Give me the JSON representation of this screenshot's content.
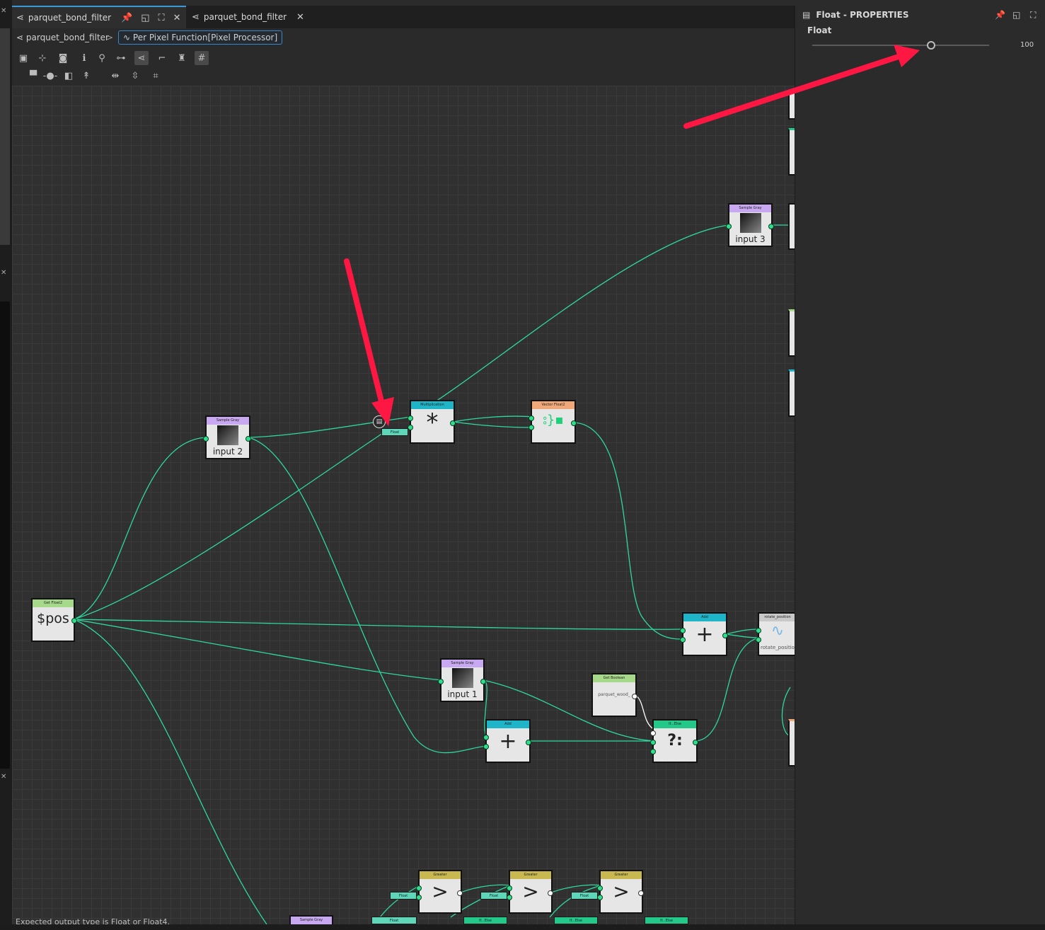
{
  "tabs": [
    {
      "label": "parquet_bond_filter",
      "active": true
    },
    {
      "label": "parquet_bond_filter",
      "active": false
    }
  ],
  "breadcrumb": {
    "root": "parquet_bond_filter",
    "separator": ">",
    "current": "Per Pixel Function[Pixel Processor]"
  },
  "nodes": {
    "get_float2": {
      "header": "Get Float2",
      "symbol": "$pos"
    },
    "sample_gray_2": {
      "header": "Sample Gray",
      "label": "input 2"
    },
    "sample_gray_3": {
      "header": "Sample Gray",
      "label": "input 3"
    },
    "sample_gray_1": {
      "header": "Sample Gray",
      "label": "input 1"
    },
    "sample_gray_bottom": {
      "header": "Sample Gray"
    },
    "multiplication": {
      "header": "Multiplication",
      "symbol": "*"
    },
    "vector_float2": {
      "header": "Vector Float2"
    },
    "add_right": {
      "header": "Add",
      "symbol": "+"
    },
    "add_center": {
      "header": "Add",
      "symbol": "+"
    },
    "rotate_position": {
      "header": "rotate_position",
      "label": "rotate_positio"
    },
    "get_boolean": {
      "header": "Get Boolean",
      "label": "parquet_wood_"
    },
    "if_else": {
      "header": "If...Else",
      "symbol": "?:"
    },
    "greater_1": {
      "header": "Greater",
      "symbol": ">"
    },
    "greater_2": {
      "header": "Greater",
      "symbol": ">"
    },
    "greater_3": {
      "header": "Greater",
      "symbol": ">"
    }
  },
  "chips": {
    "float": "Float",
    "if_else": "If...Else"
  },
  "status": "Expected output type is Float or Float4.",
  "properties": {
    "title": "Float - PROPERTIES",
    "param_label": "Float",
    "value": "100",
    "slider_fraction": 0.67
  },
  "colors": {
    "wire": "#2ed8a0",
    "annotation_arrow": "#ff1744",
    "header_sample": "#c8a8f0",
    "header_math": "#1fb5c9",
    "header_vector": "#f0a878",
    "header_get": "#a6d98a",
    "header_ifelse": "#24c98a",
    "header_greater": "#c9b84f",
    "header_rotate": "#c8c8c8"
  },
  "icons": [
    "graph-icon",
    "pin-icon",
    "float-window-icon",
    "maximize-icon",
    "close-icon",
    "function-icon",
    "document-icon"
  ]
}
